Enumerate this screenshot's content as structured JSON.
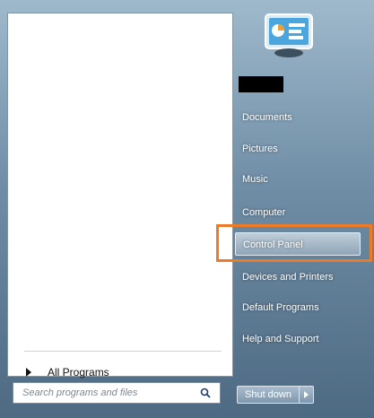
{
  "left": {
    "all_programs_label": "All Programs",
    "search": {
      "placeholder": "Search programs and files"
    }
  },
  "right": {
    "user_name": "",
    "items": [
      {
        "label": "Documents"
      },
      {
        "label": "Pictures"
      },
      {
        "label": "Music"
      },
      {
        "label": "Computer"
      },
      {
        "label": "Control Panel"
      },
      {
        "label": "Devices and Printers"
      },
      {
        "label": "Default Programs"
      },
      {
        "label": "Help and Support"
      }
    ],
    "shutdown_label": "Shut down"
  },
  "colors": {
    "highlight_frame": "#f07a24",
    "menu_gradient_top": "#9fb9cc",
    "menu_gradient_bottom": "#4d6a82"
  },
  "icons": {
    "search": "magnifier-icon",
    "user_picture": "user-picture-icon",
    "shutdown_arrow": "chevron-right-icon"
  }
}
